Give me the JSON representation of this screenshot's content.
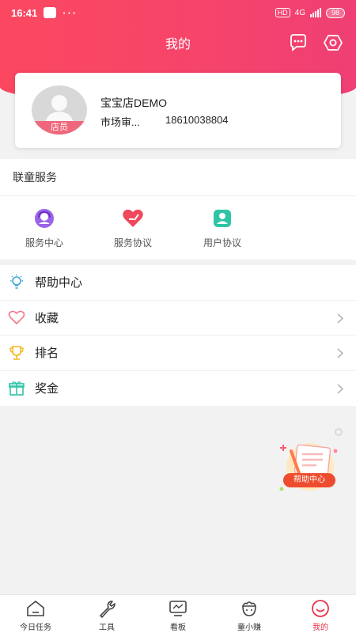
{
  "status_bar": {
    "time": "16:41",
    "dots": "···",
    "hd": "HD",
    "network": "4G",
    "battery": "98"
  },
  "header": {
    "title": "我的"
  },
  "profile": {
    "avatar_badge": "店员",
    "store_name": "宝宝店DEMO",
    "role": "市场审...",
    "phone": "18610038804"
  },
  "services": {
    "title": "联童服务",
    "items": [
      {
        "label": "服务中心",
        "icon": "headset-icon"
      },
      {
        "label": "服务协议",
        "icon": "agreement-icon"
      },
      {
        "label": "用户协议",
        "icon": "user-agreement-icon"
      }
    ]
  },
  "menu": {
    "items": [
      {
        "label": "帮助中心",
        "icon": "lightbulb-icon"
      },
      {
        "label": "收藏",
        "icon": "heart-icon"
      },
      {
        "label": "排名",
        "icon": "trophy-icon"
      },
      {
        "label": "奖金",
        "icon": "gift-icon"
      }
    ]
  },
  "floating_help": {
    "label": "帮助中心"
  },
  "bottom_nav": {
    "tabs": [
      {
        "label": "今日任务",
        "icon": "home-icon"
      },
      {
        "label": "工具",
        "icon": "wrench-icon"
      },
      {
        "label": "看板",
        "icon": "monitor-icon"
      },
      {
        "label": "童小赚",
        "icon": "bag-icon"
      },
      {
        "label": "我的",
        "icon": "face-icon"
      }
    ]
  },
  "colors": {
    "brand": "#f6446a",
    "active_tab": "#e8334a"
  }
}
